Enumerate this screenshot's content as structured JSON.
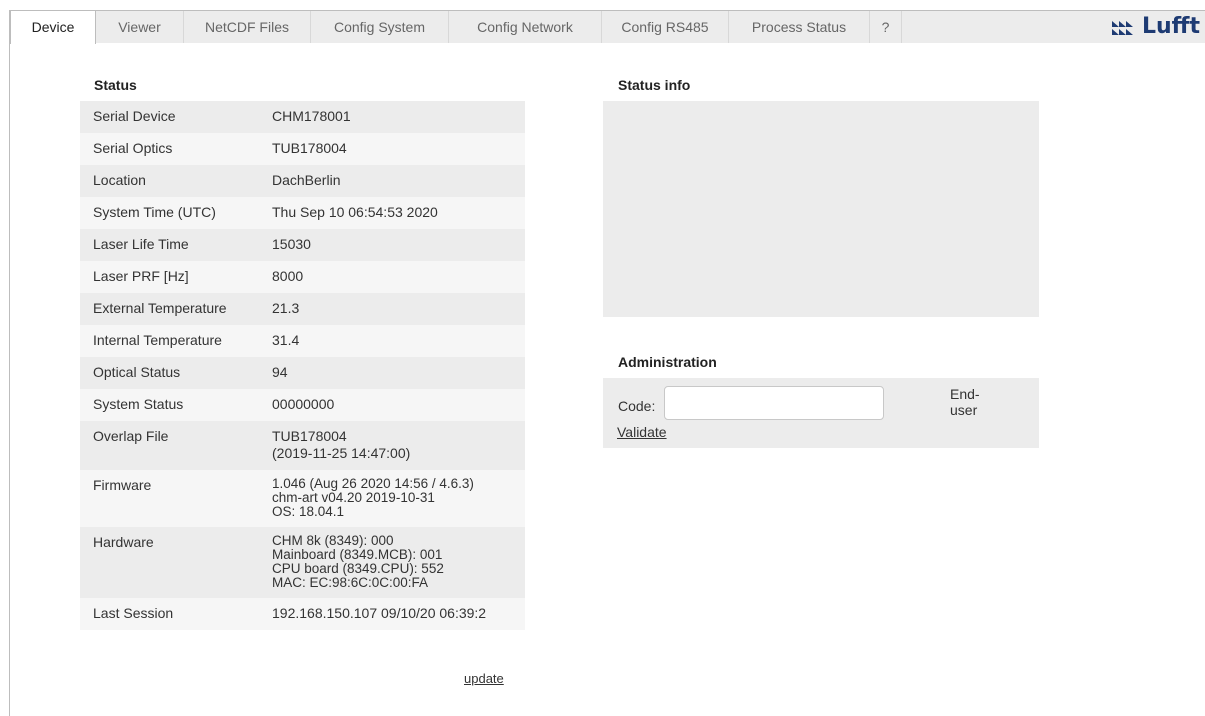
{
  "tabs": [
    {
      "label": "Device",
      "active": true
    },
    {
      "label": "Viewer",
      "active": false
    },
    {
      "label": "NetCDF Files",
      "active": false
    },
    {
      "label": "Config System",
      "active": false
    },
    {
      "label": "Config Network",
      "active": false
    },
    {
      "label": "Config RS485",
      "active": false
    },
    {
      "label": "Process Status",
      "active": false
    },
    {
      "label": "?",
      "active": false
    }
  ],
  "brand": {
    "name": "Lufft",
    "color": "#1e3b73"
  },
  "status": {
    "title": "Status",
    "rows": [
      {
        "key": "Serial Device",
        "value": "CHM178001"
      },
      {
        "key": "Serial Optics",
        "value": "TUB178004"
      },
      {
        "key": "Location",
        "value": "DachBerlin"
      },
      {
        "key": "System Time (UTC)",
        "value": "Thu Sep 10 06:54:53 2020"
      },
      {
        "key": "Laser Life Time",
        "value": "15030"
      },
      {
        "key": "Laser PRF [Hz]",
        "value": "8000"
      },
      {
        "key": "External Temperature",
        "value": "21.3"
      },
      {
        "key": "Internal Temperature",
        "value": "31.4"
      },
      {
        "key": "Optical Status",
        "value": "94"
      },
      {
        "key": "System Status",
        "value": "00000000"
      },
      {
        "key": "Overlap File",
        "value": "TUB178004\n(2019-11-25 14:47:00)"
      },
      {
        "key": "Firmware",
        "value": "1.046 (Aug 26 2020 14:56 / 4.6.3)\nchm-art v04.20 2019-10-31\nOS: 18.04.1"
      },
      {
        "key": "Hardware",
        "value": "CHM 8k (8349):  000\nMainboard (8349.MCB):  001\nCPU board (8349.CPU):  552\nMAC:  EC:98:6C:0C:00:FA"
      },
      {
        "key": "Last Session",
        "value": "192.168.150.107 09/10/20 06:39:2"
      }
    ],
    "update_label": "update"
  },
  "status_info": {
    "title": "Status info"
  },
  "administration": {
    "title": "Administration",
    "code_label": "Code:",
    "code_value": "",
    "validate_label": "Validate",
    "user_role": "End-\nuser"
  }
}
